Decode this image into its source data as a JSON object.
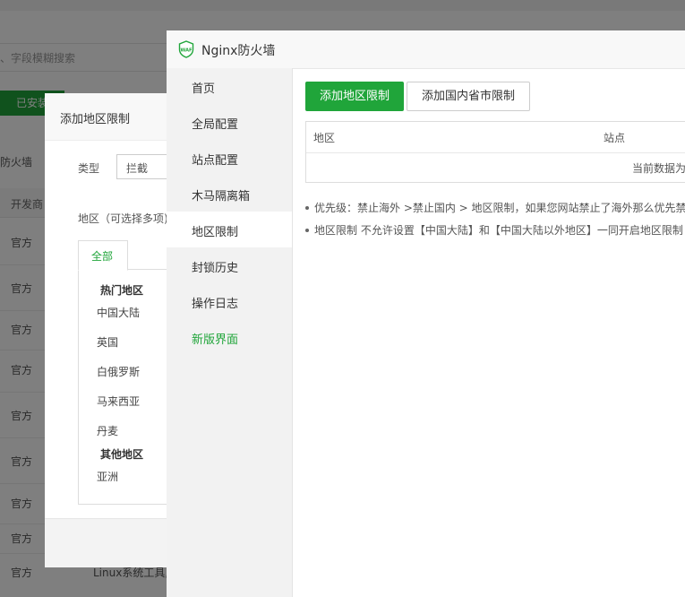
{
  "background": {
    "search_placeholder": "、字段模糊搜索",
    "installed_button": "已安装",
    "firewall_label": "防火墙",
    "developer_column": "开发商",
    "row_label": "官方",
    "bottom_text": "Linux系统工具,"
  },
  "region_dialog": {
    "title": "添加地区限制",
    "type_label": "类型",
    "type_value": "拦截",
    "region_label": "地区（可选择多项)",
    "tab_all": "全部",
    "hot_regions_heading": "热门地区",
    "hot_regions": [
      "中国大陆",
      "英国",
      "白俄罗斯",
      "马来西亚",
      "丹麦"
    ],
    "other_regions_heading": "其他地区",
    "other_regions": [
      "亚洲"
    ]
  },
  "waf": {
    "title": "Nginx防火墙",
    "logo_text": "WAF",
    "nav": [
      {
        "label": "首页"
      },
      {
        "label": "全局配置"
      },
      {
        "label": "站点配置"
      },
      {
        "label": "木马隔离箱"
      },
      {
        "label": "地区限制"
      },
      {
        "label": "封锁历史"
      },
      {
        "label": "操作日志"
      },
      {
        "label": "新版界面"
      }
    ],
    "active_nav": "地区限制",
    "buttons": {
      "add_region": "添加地区限制",
      "add_province": "添加国内省市限制"
    },
    "table": {
      "columns": [
        "地区",
        "站点"
      ],
      "empty_text": "当前数据为空"
    },
    "notes": [
      "优先级：禁止海外 >禁止国内 > 地区限制，如果您网站禁止了海外那么优先禁止海外",
      "地区限制 不允许设置【中国大陆】和【中国大陆以外地区】一同开启地区限制"
    ],
    "colors": {
      "accent": "#20a53a"
    }
  }
}
